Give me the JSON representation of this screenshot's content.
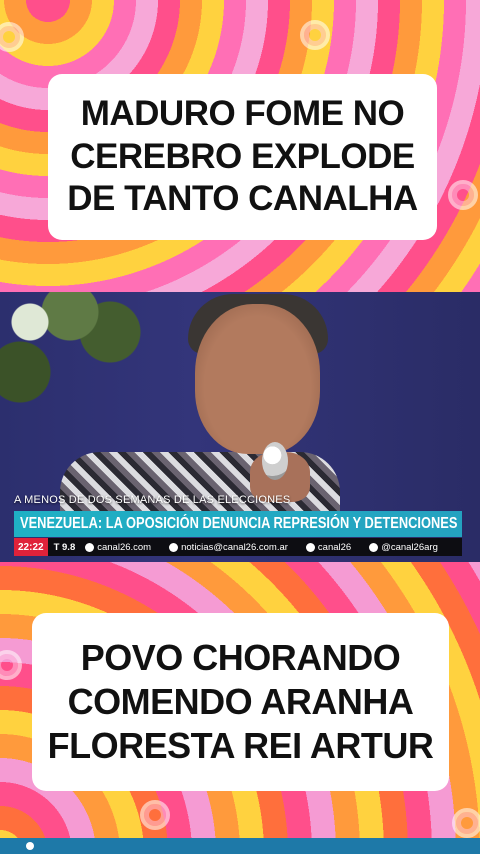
{
  "top_caption": {
    "lines": [
      "MADURO FOME NO",
      "CEREBRO EXPLODE",
      "DE TANTO CANALHA"
    ]
  },
  "video": {
    "kicker": "A MENOS DE DOS SEMANAS DE LAS ELECCIONES",
    "headline": "VENEZUELA: LA OPOSICIÓN DENUNCIA REPRESIÓN Y DETENCIONES",
    "ticker": {
      "time": "22:22",
      "temperature": "T 9.8",
      "website": "canal26.com",
      "email": "noticias@canal26.com.ar",
      "social_1": "canal26",
      "social_2": "@canal26arg"
    }
  },
  "bottom_caption": {
    "lines": [
      "POVO CHORANDO",
      "COMENDO ARANHA",
      "FLORESTA REI ARTUR"
    ]
  },
  "colors": {
    "headline_bar": "#1fb0c4",
    "ticker_time_bg": "#e0223a",
    "caption_bg": "#ffffff"
  }
}
